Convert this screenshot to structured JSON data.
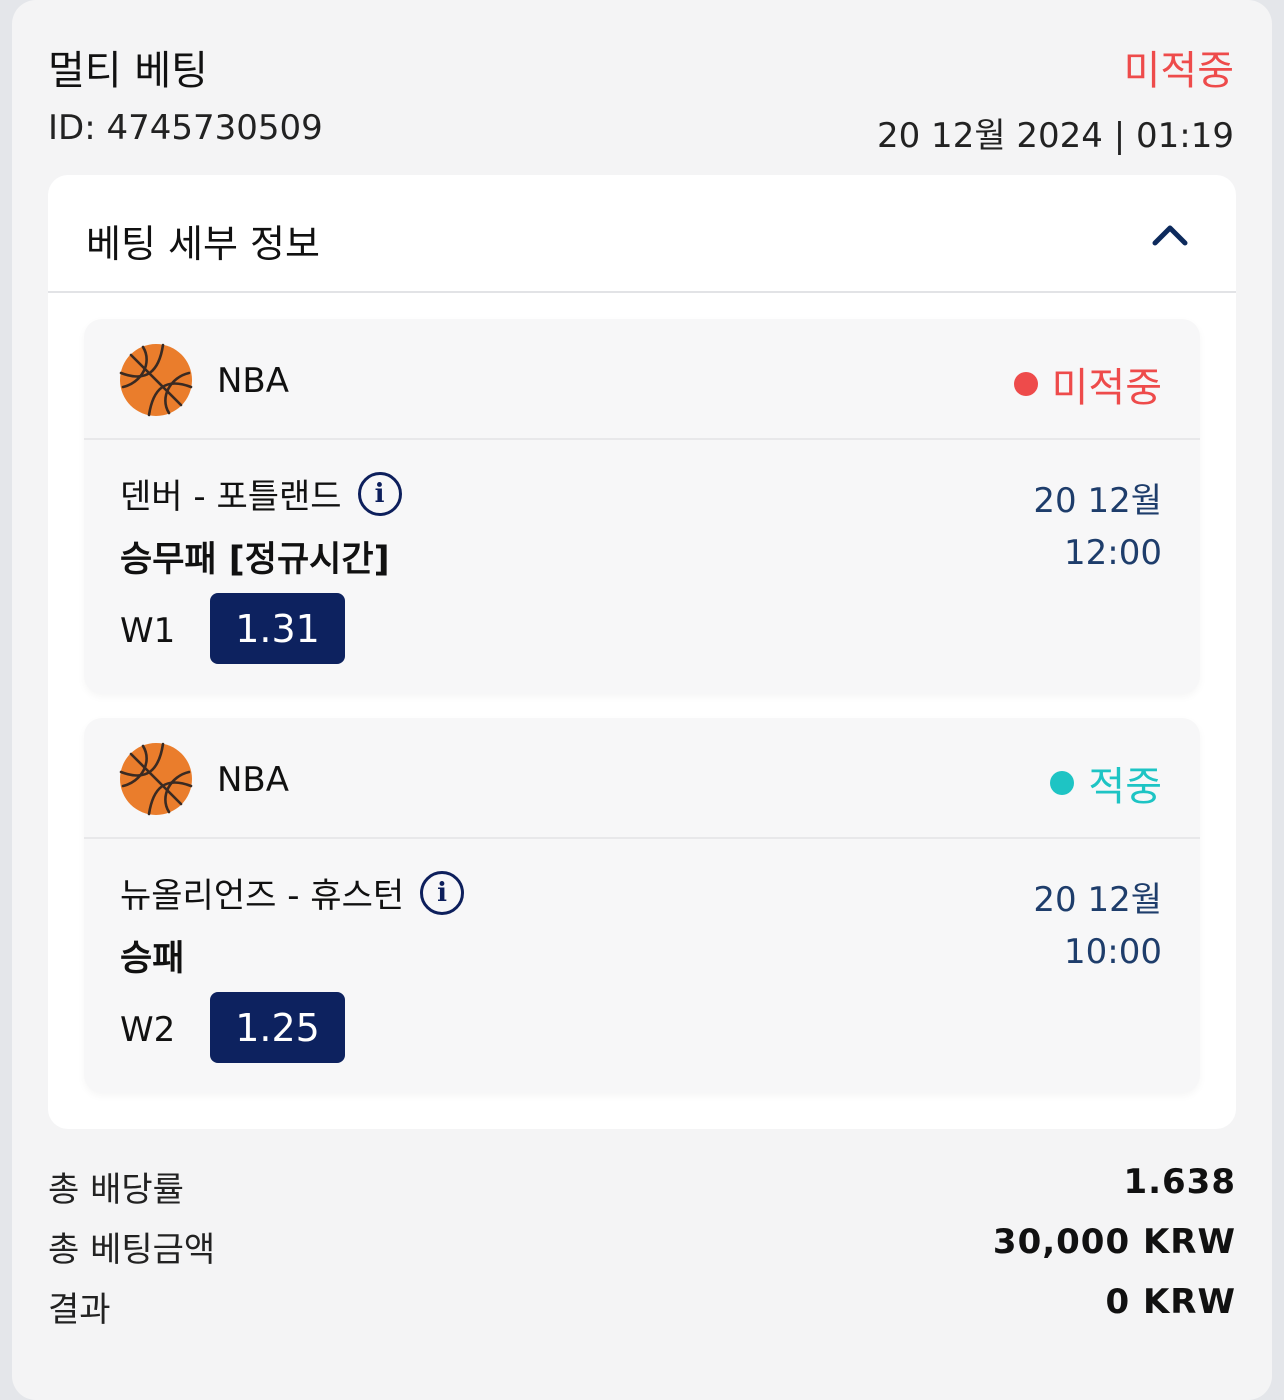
{
  "header": {
    "title": "멀티 베팅",
    "status": "미적중",
    "id_text": "ID: 4745730509",
    "datetime": "20 12월 2024 | 01:19"
  },
  "details": {
    "title": "베팅 세부 정보",
    "toggle_icon": "chevron-up-icon"
  },
  "events": [
    {
      "league": "NBA",
      "sport_icon": "basketball-icon",
      "status": "미적중",
      "status_color": "#ee4b4b",
      "match": "덴버 - 포틀랜드",
      "market": "승무패 [정규시간]",
      "date": "20 12월",
      "time": "12:00",
      "outcome": "W1",
      "odd": "1.31"
    },
    {
      "league": "NBA",
      "sport_icon": "basketball-icon",
      "status": "적중",
      "status_color": "#1ec4c4",
      "match": "뉴올리언즈 - 휴스턴",
      "market": "승패",
      "date": "20 12월",
      "time": "10:00",
      "outcome": "W2",
      "odd": "1.25"
    }
  ],
  "summary": {
    "total_odds_label": "총 배당률",
    "total_odds_value": "1.638",
    "total_stake_label": "총 베팅금액",
    "total_stake_value": "30,000 KRW",
    "result_label": "결과",
    "result_value": "0 KRW"
  },
  "colors": {
    "accent_navy": "#0d225f",
    "lose_red": "#ee4b4b",
    "win_teal": "#1ec4c4"
  }
}
